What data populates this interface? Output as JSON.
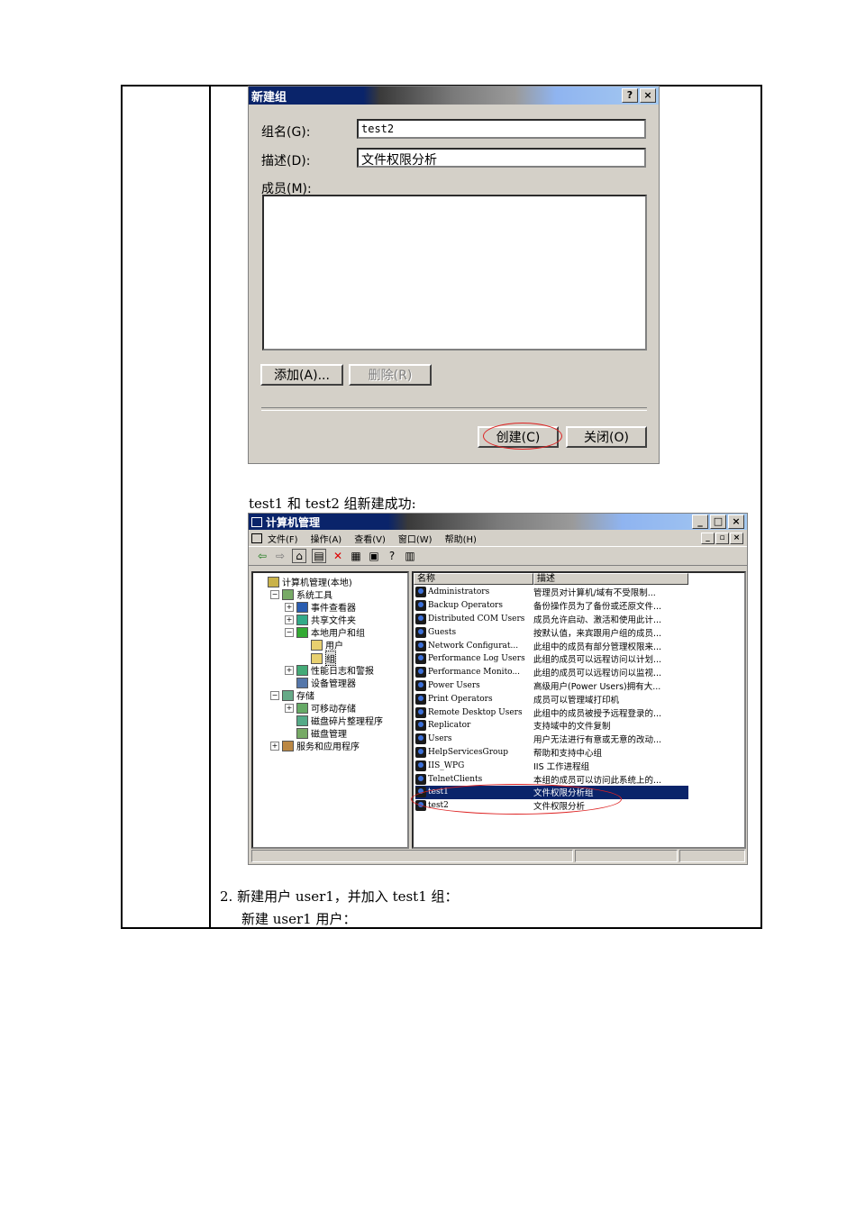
{
  "dialog": {
    "title": "新建组",
    "help_btn": "?",
    "close_btn": "×",
    "group_name_label": "组名(G):",
    "group_name_value": "test2",
    "description_label": "描述(D):",
    "description_value": "文件权限分析",
    "members_label": "成员(M):",
    "add_button": "添加(A)...",
    "remove_button": "删除(R)",
    "create_button": "创建(C)",
    "close_button": "关闭(O)"
  },
  "caption1": "test1 和 test2 组新建成功:",
  "window": {
    "title": "计算机管理",
    "title_buttons": [
      "_",
      "□",
      "×"
    ],
    "menu": [
      "文件(F)",
      "操作(A)",
      "查看(V)",
      "窗口(W)",
      "帮助(H)"
    ],
    "menu_buttons": [
      "_",
      "▫",
      "×"
    ],
    "tree": [
      {
        "label": "计算机管理(本地)",
        "indent": 0,
        "pm": ""
      },
      {
        "label": "系统工具",
        "indent": 1,
        "pm": "−"
      },
      {
        "label": "事件查看器",
        "indent": 2,
        "pm": "+"
      },
      {
        "label": "共享文件夹",
        "indent": 2,
        "pm": "+"
      },
      {
        "label": "本地用户和组",
        "indent": 2,
        "pm": "−"
      },
      {
        "label": "用户",
        "indent": 3,
        "pm": ""
      },
      {
        "label": "组",
        "indent": 3,
        "pm": ""
      },
      {
        "label": "性能日志和警报",
        "indent": 2,
        "pm": "+"
      },
      {
        "label": "设备管理器",
        "indent": 2,
        "pm": ""
      },
      {
        "label": "存储",
        "indent": 1,
        "pm": "−"
      },
      {
        "label": "可移动存储",
        "indent": 2,
        "pm": "+"
      },
      {
        "label": "磁盘碎片整理程序",
        "indent": 2,
        "pm": ""
      },
      {
        "label": "磁盘管理",
        "indent": 2,
        "pm": ""
      },
      {
        "label": "服务和应用程序",
        "indent": 1,
        "pm": "+"
      }
    ],
    "columns": [
      "名称",
      "描述"
    ],
    "rows": [
      {
        "name": "Administrators",
        "desc": "管理员对计算机/域有不受限制..."
      },
      {
        "name": "Backup Operators",
        "desc": "备份操作员为了备份或还原文件..."
      },
      {
        "name": "Distributed COM Users",
        "desc": "成员允许启动、激活和使用此计..."
      },
      {
        "name": "Guests",
        "desc": "按默认值，来宾跟用户组的成员..."
      },
      {
        "name": "Network Configurat...",
        "desc": "此组中的成员有部分管理权限来..."
      },
      {
        "name": "Performance Log Users",
        "desc": "此组的成员可以远程访问以计划..."
      },
      {
        "name": "Performance Monito...",
        "desc": "此组的成员可以远程访问以监视..."
      },
      {
        "name": "Power Users",
        "desc": "高级用户(Power Users)拥有大..."
      },
      {
        "name": "Print Operators",
        "desc": "成员可以管理域打印机"
      },
      {
        "name": "Remote Desktop Users",
        "desc": "此组中的成员被授予远程登录的..."
      },
      {
        "name": "Replicator",
        "desc": "支持域中的文件复制"
      },
      {
        "name": "Users",
        "desc": "用户无法进行有意或无意的改动..."
      },
      {
        "name": "HelpServicesGroup",
        "desc": "帮助和支持中心组"
      },
      {
        "name": "IIS_WPG",
        "desc": "IIS 工作进程组"
      },
      {
        "name": "TelnetClients",
        "desc": "本组的成员可以访问此系统上的..."
      },
      {
        "name": "test1",
        "desc": "文件权限分析组",
        "selected": true
      },
      {
        "name": "test2",
        "desc": "文件权限分析"
      }
    ]
  },
  "step2": "2.   新建用户 user1，并加入 test1 组：",
  "step2_sub": "新建 user1 用户："
}
